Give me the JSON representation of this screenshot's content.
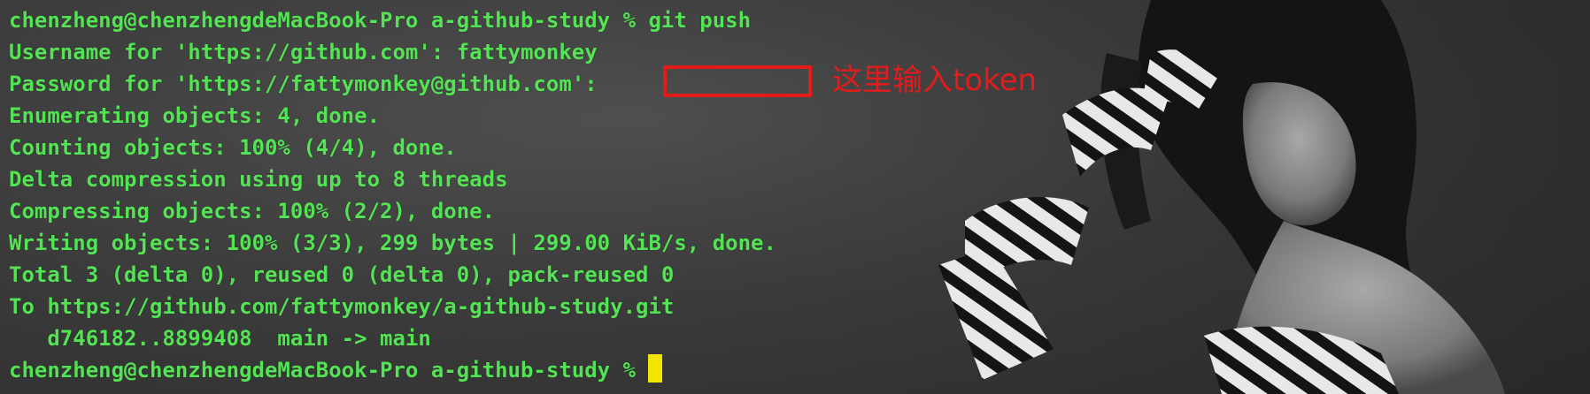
{
  "terminal": {
    "lines": [
      "chenzheng@chenzhengdeMacBook-Pro a-github-study % git push",
      "Username for 'https://github.com': fattymonkey",
      "Password for 'https://fattymonkey@github.com':",
      "Enumerating objects: 4, done.",
      "Counting objects: 100% (4/4), done.",
      "Delta compression using up to 8 threads",
      "Compressing objects: 100% (2/2), done.",
      "Writing objects: 100% (3/3), 299 bytes | 299.00 KiB/s, done.",
      "Total 3 (delta 0), reused 0 (delta 0), pack-reused 0",
      "To https://github.com/fattymonkey/a-github-study.git",
      "   d746182..8899408  main -> main",
      "chenzheng@chenzhengdeMacBook-Pro a-github-study %"
    ],
    "text_color": "#54e354",
    "cursor_color": "#f2e600"
  },
  "annotation": {
    "text": "这里输入token",
    "color": "#e21b1b"
  }
}
